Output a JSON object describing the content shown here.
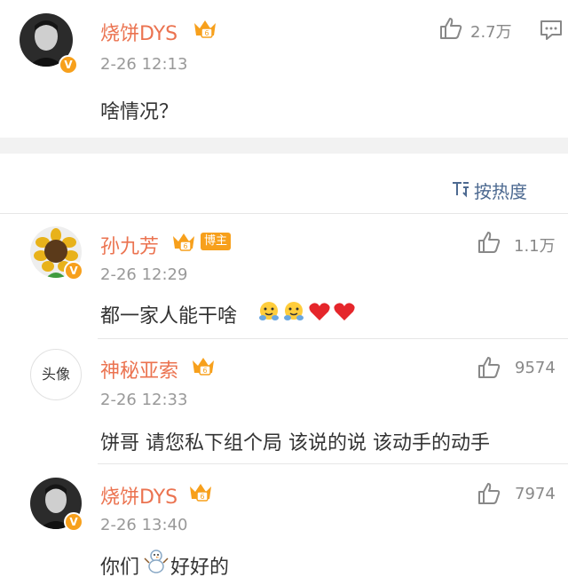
{
  "post": {
    "username": "烧饼DYS",
    "time": "2-26 12:13",
    "content": "啥情况？",
    "likes": "2.7万"
  },
  "sort": {
    "label": "按热度"
  },
  "comments": [
    {
      "username": "孙九芳",
      "tag": "博主",
      "time": "2-26 12:29",
      "content": "都一家人能干啥",
      "likes": "1.1万"
    },
    {
      "username": "神秘亚索",
      "avatar_text": "头像",
      "time": "2-26 12:33",
      "content": "饼哥 请您私下组个局 该说的说 该动手的动手",
      "likes": "9574"
    },
    {
      "username": "烧饼DYS",
      "time": "2-26 13:40",
      "content_before": "你们",
      "content_after": "好好的",
      "likes": "7974"
    }
  ],
  "colors": {
    "username": "#eb7350",
    "vip": "#f7a01c",
    "link": "#4d6a91",
    "muted": "#999999"
  },
  "icons": [
    "crown-vip-icon",
    "verified-v-icon",
    "thumbs-up-icon",
    "comment-icon",
    "sort-icon",
    "hug-emoji-icon",
    "heart-emoji-icon",
    "snowman-emoji-icon"
  ]
}
